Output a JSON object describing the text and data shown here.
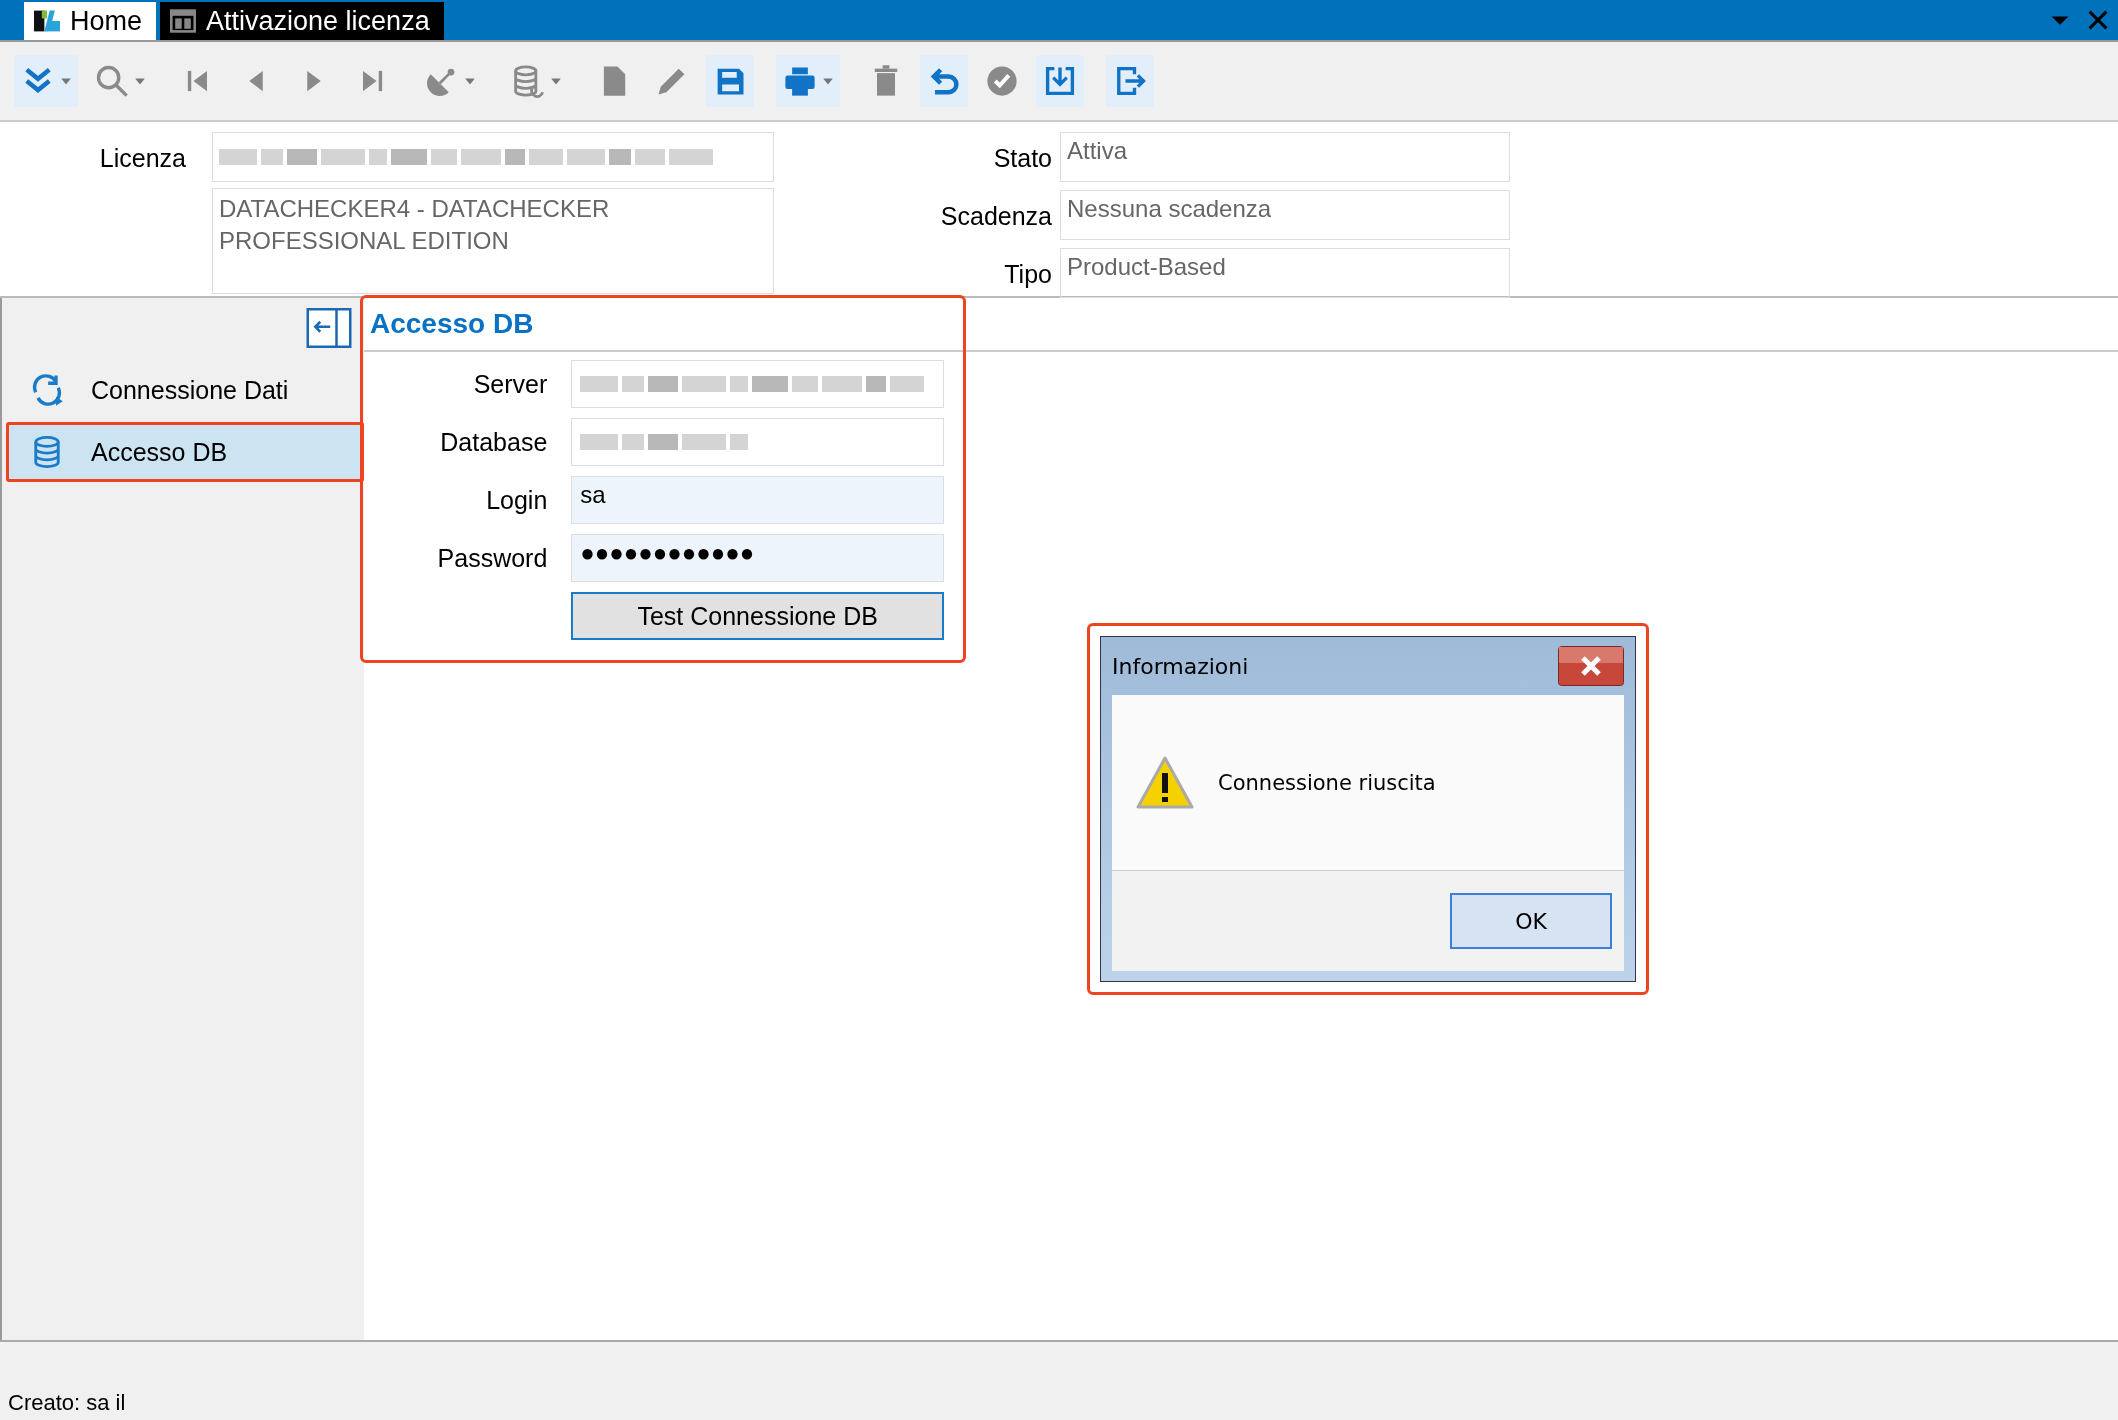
{
  "window": {
    "tabs": [
      {
        "label": "Home",
        "selected": false,
        "kind": "home"
      },
      {
        "label": "Attivazione licenza",
        "selected": true,
        "kind": "form"
      }
    ]
  },
  "toolbar": [
    [
      {
        "kind": "expand",
        "disabled": false,
        "dropdown": true
      },
      {
        "kind": "search",
        "disabled": true,
        "dropdown": true
      }
    ],
    [
      {
        "kind": "first",
        "disabled": true,
        "dropdown": false
      },
      {
        "kind": "prev",
        "disabled": true,
        "dropdown": false
      },
      {
        "kind": "next",
        "disabled": true,
        "dropdown": false
      },
      {
        "kind": "last",
        "disabled": true,
        "dropdown": false
      }
    ],
    [
      {
        "kind": "satellite",
        "disabled": true,
        "dropdown": true
      }
    ],
    [
      {
        "kind": "database",
        "disabled": true,
        "dropdown": true
      }
    ],
    [
      {
        "kind": "document",
        "disabled": true,
        "dropdown": false
      },
      {
        "kind": "pencil",
        "disabled": true,
        "dropdown": false
      },
      {
        "kind": "save",
        "disabled": false,
        "dropdown": false
      }
    ],
    [
      {
        "kind": "print",
        "disabled": false,
        "dropdown": true
      }
    ],
    [
      {
        "kind": "trash",
        "disabled": true,
        "dropdown": false
      },
      {
        "kind": "undo",
        "disabled": false,
        "dropdown": false
      },
      {
        "kind": "check",
        "disabled": true,
        "dropdown": false
      },
      {
        "kind": "import",
        "disabled": false,
        "dropdown": false
      }
    ],
    [
      {
        "kind": "exit",
        "disabled": false,
        "dropdown": false
      }
    ]
  ],
  "license": {
    "label": "Licenza",
    "key_blurred": true,
    "description": "DATACHECKER4 - DATACHECKER PROFESSIONAL EDITION",
    "fields": [
      {
        "label": "Stato",
        "value": "Attiva"
      },
      {
        "label": "Scadenza",
        "value": "Nessuna scadenza"
      },
      {
        "label": "Tipo",
        "value": "Product-Based"
      }
    ]
  },
  "sidebar": {
    "items": [
      {
        "label": "Connessione Dati",
        "kind": "sync",
        "selected": false,
        "highlighted": false
      },
      {
        "label": "Accesso DB",
        "kind": "database",
        "selected": true,
        "highlighted": true
      }
    ]
  },
  "panel": {
    "title": "Accesso DB",
    "highlighted": true,
    "fields": [
      {
        "label": "Server",
        "blurred": true,
        "editable": false
      },
      {
        "label": "Database",
        "blurred": true,
        "editable": false
      },
      {
        "label": "Login",
        "value": "sa",
        "blurred": false,
        "editable": true
      },
      {
        "label": "Password",
        "value": "●●●●●●●●●●●●",
        "blurred": false,
        "editable": true
      }
    ],
    "button": "Test Connessione DB"
  },
  "dialog": {
    "title": "Informazioni",
    "message": "Connessione riuscita",
    "button": "OK",
    "highlighted": true
  },
  "status_bar": "Creato: sa il"
}
